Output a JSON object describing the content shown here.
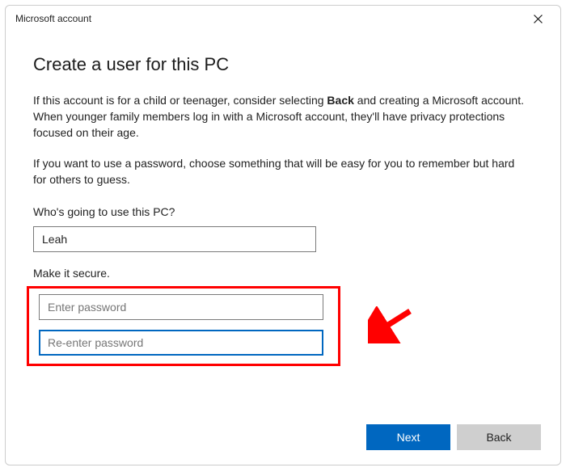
{
  "titlebar": {
    "title": "Microsoft account"
  },
  "main": {
    "heading": "Create a user for this PC",
    "para1_pre": "If this account is for a child or teenager, consider selecting ",
    "para1_bold": "Back",
    "para1_post": " and creating a Microsoft account. When younger family members log in with a Microsoft account, they'll have privacy protections focused on their age.",
    "para2": "If you want to use a password, choose something that will be easy for you to remember but hard for others to guess.",
    "username_label": "Who's going to use this PC?",
    "username_value": "Leah",
    "secure_label": "Make it secure.",
    "password_placeholder": "Enter password",
    "confirm_placeholder": "Re-enter password"
  },
  "footer": {
    "next": "Next",
    "back": "Back"
  },
  "annotation": {
    "highlight_color": "#ff0000",
    "arrow_color": "#ff0000"
  }
}
